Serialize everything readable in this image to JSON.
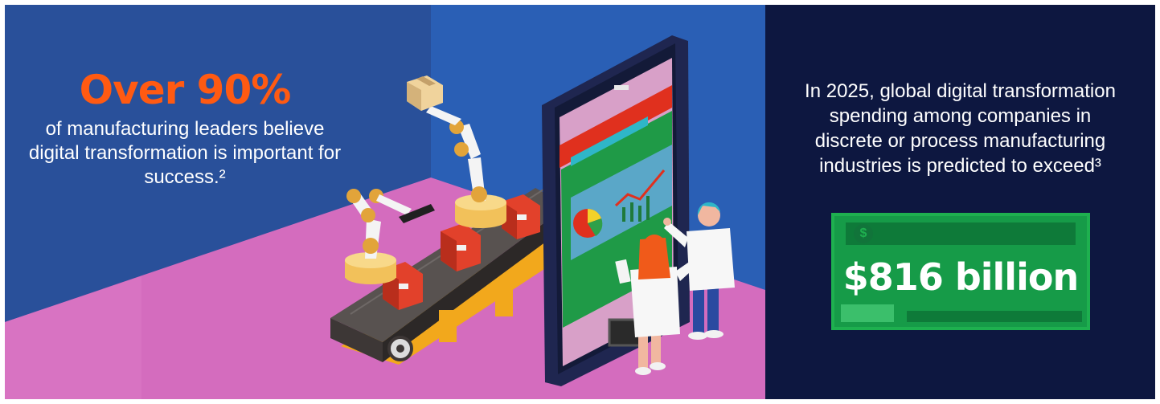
{
  "left": {
    "headline": "Over 90%",
    "text": "of manufacturing leaders believe digital transformation is important for success.²"
  },
  "right": {
    "text": "In 2025, global digital transformation spending among companies in discrete or process manufacturing industries is predicted to exceed³",
    "currency_symbol": "$",
    "amount": "$816 billion"
  },
  "colors": {
    "left_wall": "#29509a",
    "back_wall": "#2a5fb5",
    "floor": "#d46cbe",
    "right_panel": "#0d1740",
    "headline": "#ff5a12",
    "banknote": "#169b48"
  },
  "illustration": {
    "elements": [
      "robotic-arm",
      "conveyor-belt",
      "cardboard-box",
      "giant-smartphone",
      "pie-chart",
      "line-chart",
      "scientist-woman",
      "scientist-man"
    ]
  }
}
